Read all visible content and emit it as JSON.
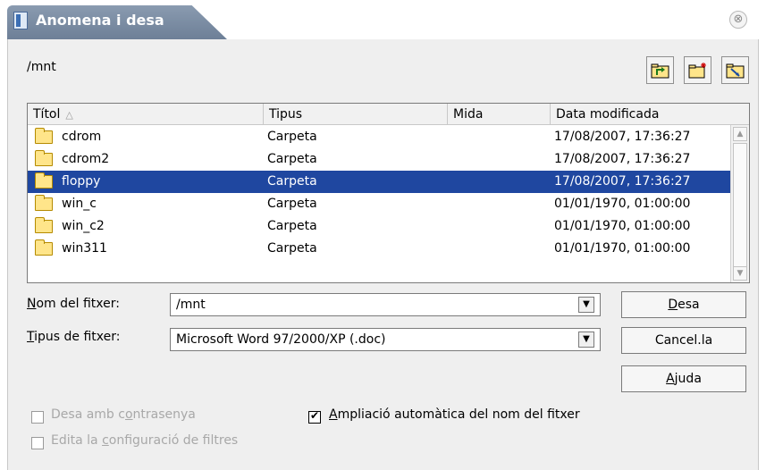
{
  "window": {
    "title": "Anomena i desa",
    "close_glyph": "⊗"
  },
  "path": "/mnt",
  "toolbar": {
    "buttons": [
      {
        "name": "up-folder-button",
        "icon": "folder-up-icon"
      },
      {
        "name": "new-folder-button",
        "icon": "new-folder-icon"
      },
      {
        "name": "default-folder-button",
        "icon": "folder-default-icon"
      }
    ]
  },
  "filelist": {
    "columns": [
      {
        "label": "Títol",
        "sort": "△"
      },
      {
        "label": "Tipus"
      },
      {
        "label": "Mida"
      },
      {
        "label": "Data modificada"
      }
    ],
    "rows": [
      {
        "name": "cdrom",
        "type": "Carpeta",
        "size": "",
        "date": "17/08/2007, 17:36:27",
        "selected": false
      },
      {
        "name": "cdrom2",
        "type": "Carpeta",
        "size": "",
        "date": "17/08/2007, 17:36:27",
        "selected": false
      },
      {
        "name": "floppy",
        "type": "Carpeta",
        "size": "",
        "date": "17/08/2007, 17:36:27",
        "selected": true
      },
      {
        "name": "win_c",
        "type": "Carpeta",
        "size": "",
        "date": "01/01/1970, 01:00:00",
        "selected": false
      },
      {
        "name": "win_c2",
        "type": "Carpeta",
        "size": "",
        "date": "01/01/1970, 01:00:00",
        "selected": false
      },
      {
        "name": "win311",
        "type": "Carpeta",
        "size": "",
        "date": "01/01/1970, 01:00:00",
        "selected": false
      }
    ],
    "scroll_up": "▲",
    "scroll_down": "▼"
  },
  "form": {
    "filename_label_key": "N",
    "filename_label_rest": "om del fitxer:",
    "filename_value": "/mnt",
    "filetype_label_key": "T",
    "filetype_label_rest": "ipus de fitxer:",
    "filetype_value": "Microsoft Word 97/2000/XP (.doc)",
    "combo_arrow": "▼"
  },
  "buttons": {
    "save_key": "D",
    "save_rest": "esa",
    "cancel": "Cancel.la",
    "help_key": "A",
    "help_rest": "juda"
  },
  "options": {
    "password_pre": "Desa amb c",
    "password_key": "o",
    "password_post": "ntrasenya",
    "password_checked": false,
    "auto_ext_key": "A",
    "auto_ext_rest": "mpliació automàtica del nom del fitxer",
    "auto_ext_checked": true,
    "filter_pre": "Edita la ",
    "filter_key": "c",
    "filter_post": "onfiguració de filtres",
    "filter_checked": false
  },
  "colors": {
    "selection": "#1f47a0",
    "title_tab": "#7386a0"
  }
}
